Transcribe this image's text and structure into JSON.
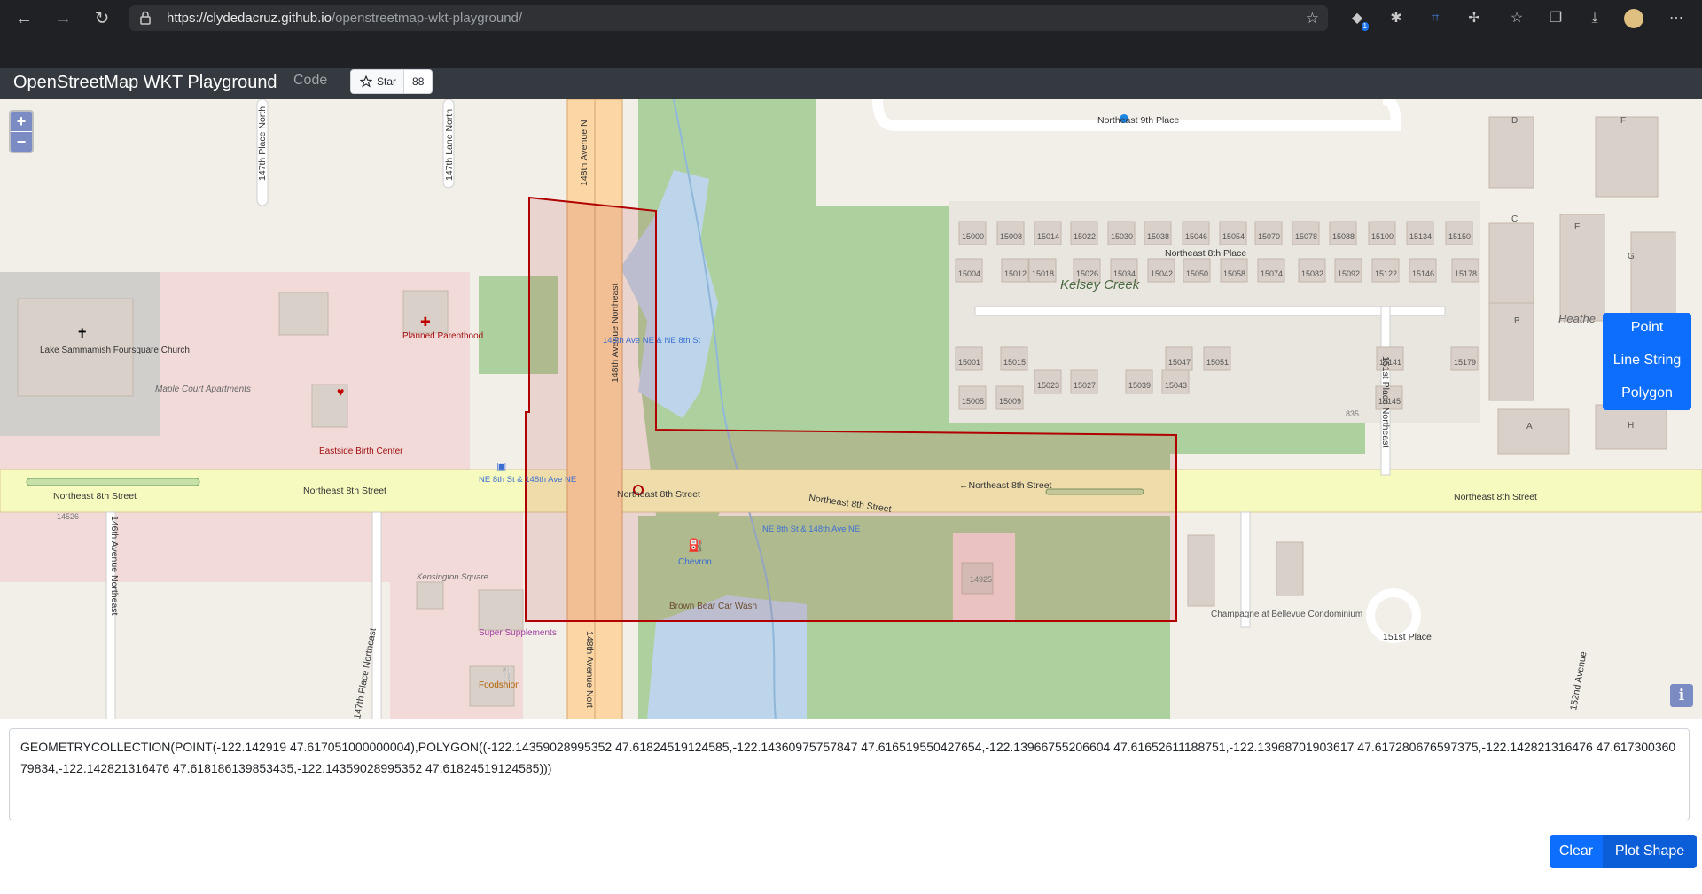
{
  "browser": {
    "url_host": "https://clydedacruz.github.io",
    "url_path": "/openstreetmap-wkt-playground/",
    "badge_count": "1"
  },
  "navbar": {
    "brand": "OpenStreetMap WKT Playground",
    "code_link": "Code",
    "star_label": "Star",
    "star_count": "88"
  },
  "map": {
    "zoom_in": "+",
    "zoom_out": "−",
    "draw_menu": [
      "Point",
      "Line String",
      "Polygon"
    ],
    "info": "i",
    "labels": {
      "ne9th": "Northeast 9th Place",
      "ne8th_place": "Northeast 8th Place",
      "ne8th_west": "Northeast 8th Street",
      "ne8th_mid_w": "Northeast 8th Street",
      "ne8th_center": "Northeast 8th Street",
      "ne8th_rot": "Northeast 8th Street",
      "ne8th_east_arrow": "←Northeast 8th Street",
      "ne8th_far_east": "Northeast 8th Street",
      "ave148_top": "148th Avenue N",
      "ave148_ne": "148th Avenue Northeast",
      "ave148_bottom": "148th Avenue Nort",
      "pl147_top": "147th Place North",
      "ln147": "147th Lane North",
      "ave146": "146th Avenue Northeast",
      "pl147_bottom": "147th Place Northeast",
      "pl151": "151st Place Northeast",
      "pl151_circle": "151st Place",
      "ave152": "152nd Avenue",
      "kelsey_creek": "Kelsey Creek",
      "church": "Lake Sammamish Foursquare Church",
      "planned_parenthood": "Planned Parenthood",
      "maple_court": "Maple Court Apartments",
      "eastside_birth": "Eastside Birth Center",
      "bus_148_ne8": "148th Ave NE & NE 8th St",
      "bus_ne8_148_west": "NE 8th St & 148th Ave NE",
      "bus_ne8_148_east": "NE 8th St & 148th Ave NE",
      "chevron": "Chevron",
      "brown_bear": "Brown Bear Car Wash",
      "super_supplements": "Super Supplements",
      "foodshion": "Foodshion",
      "kensington": "Kensington Square",
      "champagne": "Champagne at Bellevue Condominium",
      "heather": "Heathe",
      "addr_14526": "14526",
      "addr_14925": "14925",
      "addr_835": "835",
      "houses_row1": [
        "15000",
        "15008",
        "15014",
        "15022",
        "15030",
        "15038",
        "15046",
        "15054",
        "15070",
        "15078",
        "15088",
        "15100",
        "15134",
        "15150"
      ],
      "houses_row2": [
        "15004",
        "15012",
        "15018",
        "15026",
        "15034",
        "15042",
        "15050",
        "15058",
        "15074",
        "15082",
        "15092",
        "15122",
        "15146",
        "15178"
      ],
      "houses_row3": [
        "15001",
        "15015",
        "15047",
        "15051",
        "15141",
        "15179"
      ],
      "houses_row4": [
        "15023",
        "15027",
        "15039",
        "15043"
      ],
      "houses_row5": [
        "15005",
        "15009",
        "15145"
      ],
      "blocks": [
        "D",
        "F",
        "C",
        "E",
        "G",
        "B",
        "A",
        "H"
      ]
    }
  },
  "wkt": {
    "value": "GEOMETRYCOLLECTION(POINT(-122.142919 47.617051000000004),POLYGON((-122.14359028995352 47.61824519124585,-122.14360975757847 47.616519550427654,-122.13966755206604 47.61652611188751,-122.13968701903617 47.617280676597375,-122.142821316476 47.61730036079834,-122.142821316476 47.618186139853435,-122.14359028995352 47.61824519124585)))"
  },
  "buttons": {
    "clear": "Clear",
    "plot": "Plot Shape"
  },
  "colors": {
    "primary": "#0d6efd",
    "navbar": "#343a40",
    "polygon_stroke": "#b00000",
    "road_major": "#f7fabf",
    "road_trunk": "#fcd6a4",
    "park": "#add19e"
  }
}
